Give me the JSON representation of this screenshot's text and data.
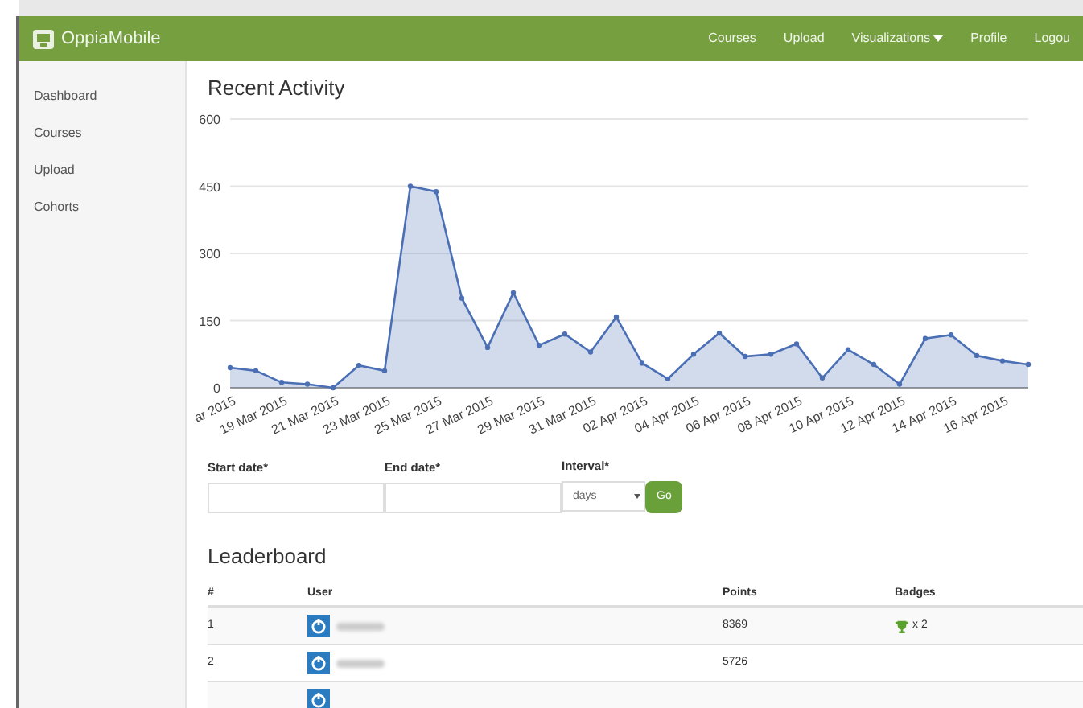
{
  "navbar": {
    "brand": "OppiaMobile",
    "links": [
      {
        "label": "Courses",
        "kind": "link"
      },
      {
        "label": "Upload",
        "kind": "link"
      },
      {
        "label": "Visualizations",
        "kind": "dropdown"
      },
      {
        "label": "Profile",
        "kind": "link"
      },
      {
        "label": "Logou",
        "kind": "link"
      }
    ]
  },
  "sidebar": {
    "items": [
      "Dashboard",
      "Courses",
      "Upload",
      "Cohorts"
    ]
  },
  "recent_activity": {
    "title": "Recent Activity",
    "chart_data": {
      "type": "area",
      "grid": true,
      "categories": [
        "ar 2015",
        null,
        "19 Mar 2015",
        null,
        "21 Mar 2015",
        null,
        "23 Mar 2015",
        null,
        "25 Mar 2015",
        null,
        "27 Mar 2015",
        null,
        "29 Mar 2015",
        null,
        "31 Mar 2015",
        null,
        "02 Apr 2015",
        null,
        "04 Apr 2015",
        null,
        "06 Apr 2015",
        null,
        "08 Apr 2015",
        null,
        "10 Apr 2015",
        null,
        "12 Apr 2015",
        null,
        "14 Apr 2015",
        null,
        "16 Apr 2015",
        null
      ],
      "series": [
        {
          "color": "#4a6fb5",
          "values": [
            45,
            38,
            12,
            8,
            0,
            50,
            38,
            450,
            438,
            200,
            90,
            212,
            95,
            120,
            80,
            158,
            55,
            20,
            75,
            122,
            70,
            75,
            98,
            22,
            85,
            52,
            8,
            110,
            118,
            72,
            60,
            52
          ]
        }
      ],
      "ylim": [
        0,
        600
      ],
      "yticks": [
        0,
        150,
        300,
        450,
        600
      ]
    }
  },
  "form": {
    "fields": [
      {
        "label": "Start date*",
        "kind": "text"
      },
      {
        "label": "End date*",
        "kind": "text"
      },
      {
        "label": "Interval*",
        "kind": "select",
        "value": "days"
      }
    ],
    "submit": "Go"
  },
  "leaderboard": {
    "title": "Leaderboard",
    "columns": [
      "#",
      "User",
      "Points",
      "Badges"
    ],
    "rows": [
      {
        "rank": "1",
        "points": "8369",
        "badges": "x 2"
      },
      {
        "rank": "2",
        "points": "5726"
      },
      {
        "rank": ""
      }
    ]
  }
}
